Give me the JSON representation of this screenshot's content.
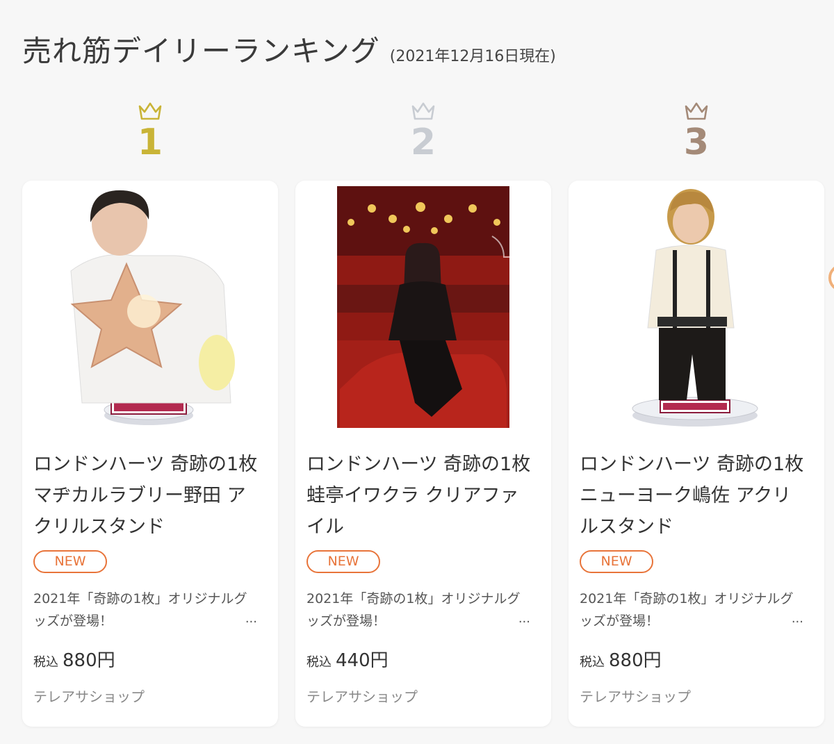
{
  "header": {
    "title": "売れ筋デイリーランキング",
    "date": "(2021年12月16日現在)"
  },
  "colors": {
    "gold": "#c9b437",
    "silver": "#c8ccd2",
    "bronze": "#a48a78",
    "new_badge": "#e8743a"
  },
  "products": [
    {
      "rank": "1",
      "title": "ロンドンハーツ 奇跡の1枚 マヂカルラブリー野田 アクリルスタンド",
      "badge": "NEW",
      "description": "2021年「奇跡の1枚」オリジナルグッズが登場！",
      "ellipsis": "...",
      "price_label": "税込",
      "price": "880円",
      "shop": "テレアサショップ",
      "image": "acrylic-stand-noda"
    },
    {
      "rank": "2",
      "title": "ロンドンハーツ 奇跡の1枚 蛙亭イワクラ クリアファイル",
      "badge": "NEW",
      "description": "2021年「奇跡の1枚」オリジナルグッズが登場！",
      "ellipsis": "...",
      "price_label": "税込",
      "price": "440円",
      "shop": "テレアサショップ",
      "image": "clear-file-iwakura"
    },
    {
      "rank": "3",
      "title": "ロンドンハーツ 奇跡の1枚 ニューヨーク嶋佐 アクリルスタンド",
      "badge": "NEW",
      "description": "2021年「奇跡の1枚」オリジナルグッズが登場！",
      "ellipsis": "...",
      "price_label": "税込",
      "price": "880円",
      "shop": "テレアサショップ",
      "image": "acrylic-stand-shimasa"
    }
  ]
}
